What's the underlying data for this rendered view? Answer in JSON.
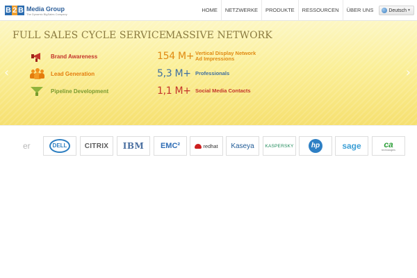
{
  "header": {
    "brand_name": "Media Group",
    "brand_tagline": "The Dynamic BigSales Company",
    "logo_letters": [
      "B",
      "2",
      "B"
    ],
    "nav": [
      "HOME",
      "NETZWERKE",
      "PRODUKTE",
      "RESSOURCEN",
      "ÜBER UNS"
    ],
    "language": "Deutsch"
  },
  "hero": {
    "left_title": "FULL SALES CYCLE SERVICE",
    "right_title": "MASSIVE NETWORK",
    "services": [
      {
        "label": "Brand Awareness",
        "icon": "megaphone-icon",
        "color": "#c3342a"
      },
      {
        "label": "Lead Generation",
        "icon": "people-icon",
        "color": "#e47c0c"
      },
      {
        "label": "Pipeline Development",
        "icon": "funnel-icon",
        "color": "#7a9a2e"
      }
    ],
    "metrics": [
      {
        "value": "154 M+",
        "label_line1": "Vertical Display Network",
        "label_line2": "Ad Impressions",
        "value_color": "#e08a12",
        "label_color": "#e08a12"
      },
      {
        "value": "5,3 M+",
        "label_line1": "Professionals",
        "label_line2": "",
        "value_color": "#3f6f9f",
        "label_color": "#3f6f9f"
      },
      {
        "value": "1,1 M+",
        "label_line1": "Social Media Contacts",
        "label_line2": "",
        "value_color": "#c3342a",
        "label_color": "#c3342a"
      }
    ]
  },
  "partners": {
    "fade_text": "er",
    "logos": [
      "DELL",
      "CITRIX",
      "IBM",
      "EMC²",
      "redhat",
      "Kaseya",
      "KASPERSKY",
      "hp",
      "sage",
      "ca"
    ],
    "ca_sub": "technologies"
  },
  "colors": {
    "hero_top": "#fdf7c4",
    "hero_bottom": "#f6e070",
    "heading": "#8a7a3f",
    "brand_blue": "#2d5f9a"
  }
}
